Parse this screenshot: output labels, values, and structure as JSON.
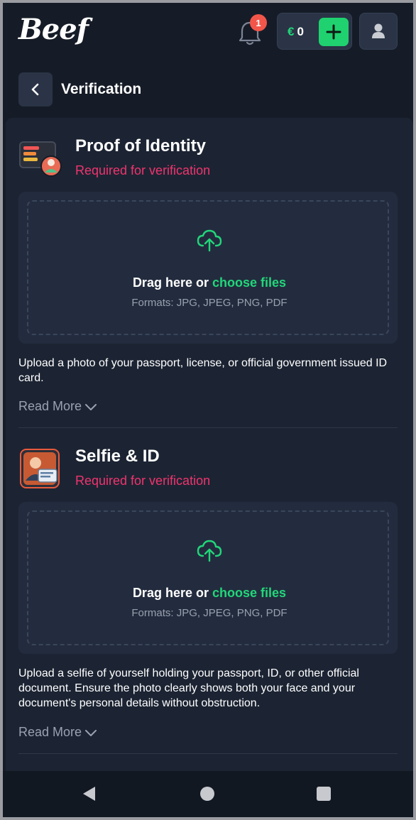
{
  "header": {
    "logo": "Beef",
    "notifications_count": "1",
    "wallet": {
      "currency": "€",
      "balance": "0"
    }
  },
  "page": {
    "title": "Verification"
  },
  "sections": [
    {
      "title": "Proof of Identity",
      "subtitle": "Required for verification",
      "drag_text": "Drag here or",
      "choose_files": "choose files",
      "formats": "Formats: JPG, JPEG, PNG, PDF",
      "description": "Upload a photo of your passport, license, or official government issued ID card.",
      "read_more": "Read More"
    },
    {
      "title": "Selfie & ID",
      "subtitle": "Required for verification",
      "drag_text": "Drag here or",
      "choose_files": "choose files",
      "formats": "Formats: JPG, JPEG, PNG, PDF",
      "description": "Upload a selfie of yourself holding your passport, ID, or other official document. Ensure the photo clearly shows both your face and your document's personal details without obstruction.",
      "read_more": "Read More"
    }
  ],
  "colors": {
    "accent_green": "#22d67a",
    "required_pink": "#f0346e",
    "background": "#161c27",
    "panel": "#1c2433"
  },
  "icons": [
    "bell-icon",
    "plus-icon",
    "user-icon",
    "chevron-left-icon",
    "id-card-icon",
    "selfie-id-icon",
    "cloud-upload-icon",
    "chevron-down-icon"
  ]
}
